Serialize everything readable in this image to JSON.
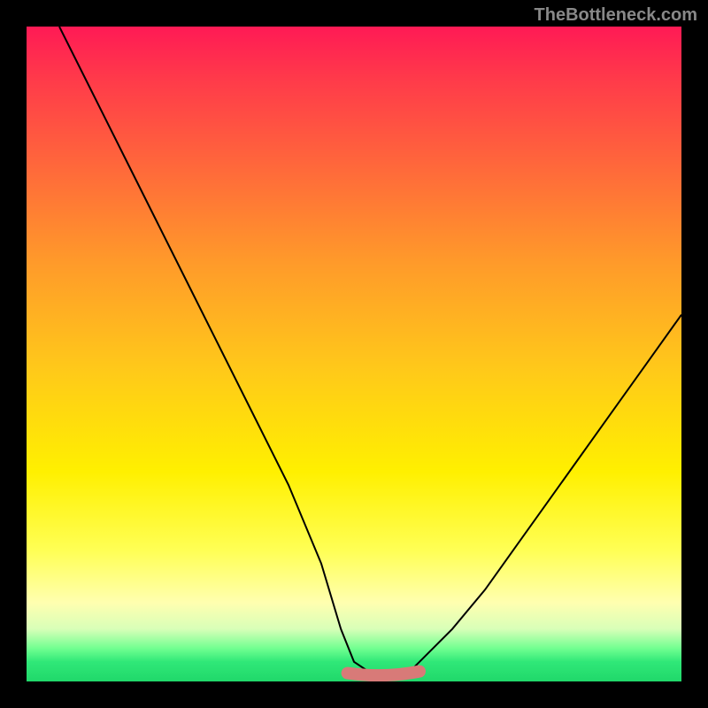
{
  "watermark": "TheBottleneck.com",
  "chart_data": {
    "type": "line",
    "title": "",
    "xlabel": "",
    "ylabel": "",
    "xlim": [
      0,
      100
    ],
    "ylim": [
      0,
      100
    ],
    "series": [
      {
        "name": "bottleneck-curve",
        "x": [
          5,
          10,
          15,
          20,
          25,
          30,
          35,
          40,
          45,
          48,
          50,
          53,
          56,
          58,
          60,
          65,
          70,
          75,
          80,
          85,
          90,
          95,
          100
        ],
        "y": [
          100,
          90,
          80,
          70,
          60,
          50,
          40,
          30,
          18,
          8,
          3,
          1,
          1,
          1,
          3,
          8,
          14,
          21,
          28,
          35,
          42,
          49,
          56
        ]
      }
    ],
    "annotations": [
      {
        "name": "valley-marker",
        "x_start": 49,
        "x_end": 60,
        "y": 1
      }
    ],
    "gradient_stops": [
      {
        "pos": 0,
        "color": "#ff1a55"
      },
      {
        "pos": 68,
        "color": "#fff000"
      },
      {
        "pos": 100,
        "color": "#20d86a"
      }
    ]
  }
}
